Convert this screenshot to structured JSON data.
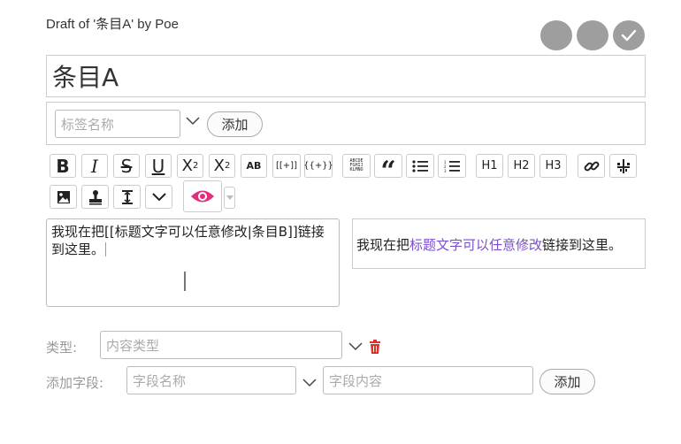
{
  "header": {
    "draft_title": "Draft of '条目A' by Poe",
    "buttons": [
      {
        "icon": "blank-circle-icon"
      },
      {
        "icon": "blank-circle-icon"
      },
      {
        "icon": "check-icon"
      }
    ]
  },
  "title": "条目A",
  "tags": {
    "placeholder": "标签名称",
    "add_label": "添加"
  },
  "toolbar": {
    "row1": [
      {
        "name": "bold",
        "label": "B"
      },
      {
        "name": "italic",
        "label": "I"
      },
      {
        "name": "strikethrough",
        "label": "S"
      },
      {
        "name": "underline",
        "label": "U"
      },
      {
        "name": "superscript",
        "label": "X",
        "sup": "2"
      },
      {
        "name": "subscript",
        "label": "X",
        "sub": "2"
      },
      {
        "name": "smallcaps",
        "label": "AB"
      },
      {
        "name": "wikilink",
        "label": "[[+]]"
      },
      {
        "name": "transclude",
        "label": "{{+}}"
      },
      {
        "name": "monospace",
        "label": "ABCDE FGHIJ KLMNO"
      },
      {
        "name": "quote",
        "label": "“"
      },
      {
        "name": "bulleted-list",
        "label": ""
      },
      {
        "name": "numbered-list",
        "label": ""
      },
      {
        "name": "heading-1",
        "label": "H1"
      },
      {
        "name": "heading-2",
        "label": "H2"
      },
      {
        "name": "heading-3",
        "label": "H3"
      },
      {
        "name": "link",
        "label": ""
      },
      {
        "name": "excise",
        "label": ""
      }
    ],
    "row2": [
      {
        "name": "picture",
        "label": ""
      },
      {
        "name": "stamp",
        "label": ""
      },
      {
        "name": "size",
        "label": ""
      },
      {
        "name": "more",
        "label": ""
      },
      {
        "name": "preview",
        "label": ""
      }
    ],
    "accent": "#e0307a"
  },
  "editor": {
    "text": "我现在把[[标题文字可以任意修改|条目B]]链接到这里。"
  },
  "preview": {
    "before": "我现在把",
    "link": "标题文字可以任意修改",
    "after": "链接到这里。",
    "link_color": "#7a4fc9"
  },
  "type_row": {
    "label": "类型:",
    "placeholder": "内容类型",
    "delete_color": "#d9342b"
  },
  "field_row": {
    "label": "添加字段:",
    "name_placeholder": "字段名称",
    "value_placeholder": "字段内容",
    "add_label": "添加"
  }
}
